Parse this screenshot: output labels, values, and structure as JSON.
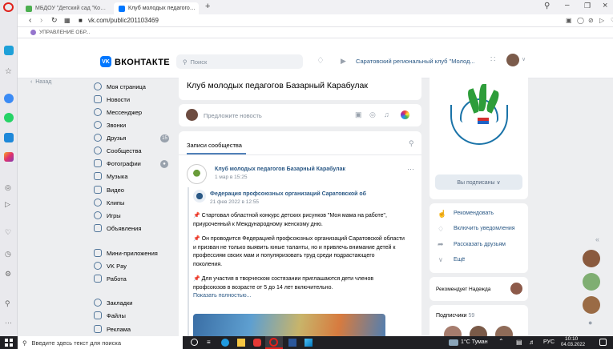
{
  "browser": {
    "tabs": [
      {
        "title": "МБДОУ \"Детский сад \"Ко…"
      },
      {
        "title": "Клуб молодых педагого…"
      }
    ],
    "new_tab": "+",
    "url": "vk.com/public201103469",
    "bookmark": "УПРАВЛЕНИЕ ОБР..."
  },
  "header": {
    "logo": "ВКОНТАКТЕ",
    "logo_mark": "VK",
    "search_placeholder": "Поиск",
    "now_playing": "Саратовский региональный клуб \"Молод..."
  },
  "sidebar": {
    "back": "Назад",
    "items": [
      {
        "label": "Моя страница"
      },
      {
        "label": "Новости"
      },
      {
        "label": "Мессенджер"
      },
      {
        "label": "Звонки"
      },
      {
        "label": "Друзья",
        "badge": "15"
      },
      {
        "label": "Сообщества"
      },
      {
        "label": "Фотографии"
      },
      {
        "label": "Музыка"
      },
      {
        "label": "Видео"
      },
      {
        "label": "Клипы"
      },
      {
        "label": "Игры"
      },
      {
        "label": "Объявления"
      },
      {
        "label": "Мини-приложения"
      },
      {
        "label": "VK Pay"
      },
      {
        "label": "Работа"
      },
      {
        "label": "Закладки"
      },
      {
        "label": "Файлы"
      },
      {
        "label": "Реклама"
      }
    ]
  },
  "main": {
    "page_title": "Клуб молодых педагогов Базарный Карабулак",
    "composer_placeholder": "Предложите новость",
    "wall_tab": "Записи сообщества",
    "post": {
      "author": "Клуб молодых педагогов Базарный Карабулак",
      "date": "1 мар в 15:25",
      "more": "···",
      "repost_author": "Федерация профсоюзных организаций Саратовской об",
      "repost_date": "21 фев 2022 в 12:55",
      "paragraphs": [
        [
          "📌 Стартовал областной конкурс детских рисунков \"Моя мама на работе\",",
          "приуроченный к Международному женскому дню."
        ],
        [
          "📌 Он проводится Федерацией профсоюзных организаций Саратовской области",
          "и призван не только выявить юные таланты, но и привлечь внимание детей к",
          "профессиям своих мам и популяризовать труд среди подрастающего",
          "поколения."
        ],
        [
          "📌 Для участия в творческом состязании приглашаются дети членов",
          "профсоюзов в возрасте от 5 до 14 лет включительно."
        ]
      ],
      "show_more": "Показать полностью..."
    }
  },
  "right": {
    "subscribed_button": "Вы подписаны ∨",
    "actions": [
      "Рекомендовать",
      "Включить уведомления",
      "Рассказать друзьям",
      "Ещё"
    ],
    "recommends": "Рекомендует Надежда",
    "followers_label": "Подписчики",
    "followers_count": "59"
  },
  "taskbar": {
    "search_placeholder": "Введите здесь текст для поиска",
    "weather": "1°C Туман",
    "lang": "РУС",
    "time": "10:10",
    "date": "04.03.2022"
  },
  "colors": {
    "vk_blue": "#0077ff",
    "link": "#2a5885",
    "bg": "#edeef0",
    "taskbar": "#202024"
  }
}
